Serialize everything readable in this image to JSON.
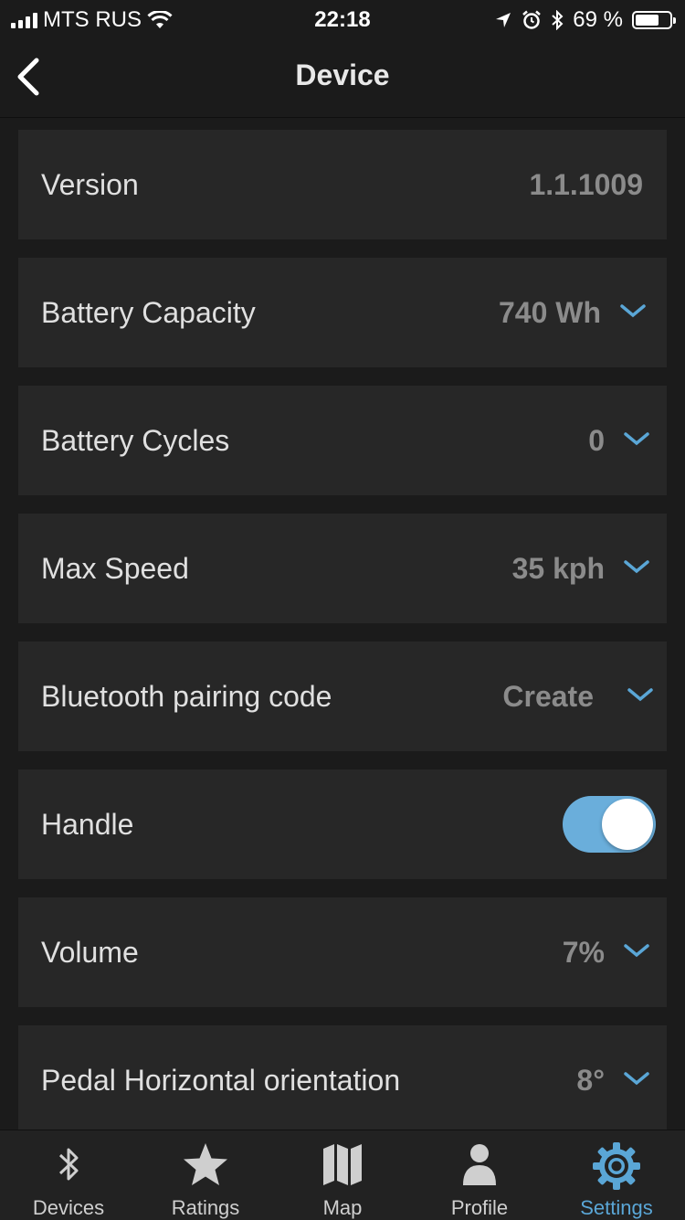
{
  "status_bar": {
    "carrier": "MTS RUS",
    "time": "22:18",
    "battery_percent": "69 %",
    "battery_level": 0.69
  },
  "nav": {
    "title": "Device",
    "back_icon": "chevron-left-icon"
  },
  "rows": [
    {
      "label": "Version",
      "value": "1.1.1009"
    },
    {
      "label": "Battery Capacity",
      "value": "740 Wh"
    },
    {
      "label": "Battery Cycles",
      "value": "0"
    },
    {
      "label": "Max Speed",
      "value": "35 kph"
    },
    {
      "label": "Bluetooth pairing code",
      "value": "Create"
    },
    {
      "label": "Handle",
      "toggle_on": true
    },
    {
      "label": "Volume",
      "value": "7%"
    },
    {
      "label": "Pedal Horizontal orientation",
      "value": "8°"
    }
  ],
  "tabs": [
    {
      "label": "Devices",
      "icon": "bluetooth-icon"
    },
    {
      "label": "Ratings",
      "icon": "star-icon"
    },
    {
      "label": "Map",
      "icon": "map-icon"
    },
    {
      "label": "Profile",
      "icon": "person-icon"
    },
    {
      "label": "Settings",
      "icon": "gear-icon",
      "active": true
    }
  ],
  "colors": {
    "accent": "#5aa6d6",
    "toggle_on": "#6aaedb",
    "background": "#1b1b1b",
    "row_bg": "#272727"
  }
}
